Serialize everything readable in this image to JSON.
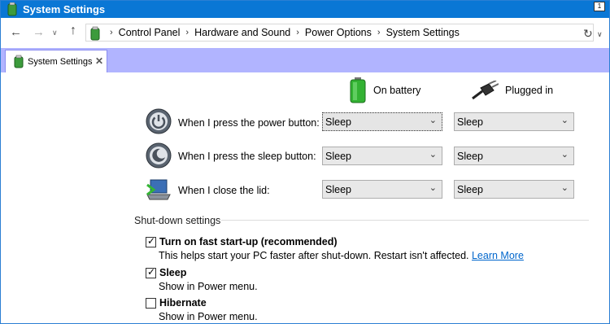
{
  "window": {
    "title": "System Settings"
  },
  "breadcrumb": [
    "Control Panel",
    "Hardware and Sound",
    "Power Options",
    "System Settings"
  ],
  "tab": {
    "label": "System Settings"
  },
  "columns": {
    "battery": "On battery",
    "plugged": "Plugged in"
  },
  "rows": [
    {
      "label": "When I press the power button:",
      "battery": "Sleep",
      "plugged": "Sleep"
    },
    {
      "label": "When I press the sleep button:",
      "battery": "Sleep",
      "plugged": "Sleep"
    },
    {
      "label": "When I close the lid:",
      "battery": "Sleep",
      "plugged": "Sleep"
    }
  ],
  "shutdown": {
    "title": "Shut-down settings",
    "fast_startup": {
      "label": "Turn on fast start-up (recommended)",
      "checked": true,
      "desc": "This helps start your PC faster after shut-down. Restart isn't affected.",
      "link": "Learn More"
    },
    "sleep": {
      "label": "Sleep",
      "checked": true,
      "desc": "Show in Power menu."
    },
    "hibernate": {
      "label": "Hibernate",
      "checked": false,
      "desc": "Show in Power menu."
    }
  },
  "colors": {
    "titlebar": "#0a77d5",
    "tabbar": "#b1b4ff",
    "link": "#0066cc"
  }
}
